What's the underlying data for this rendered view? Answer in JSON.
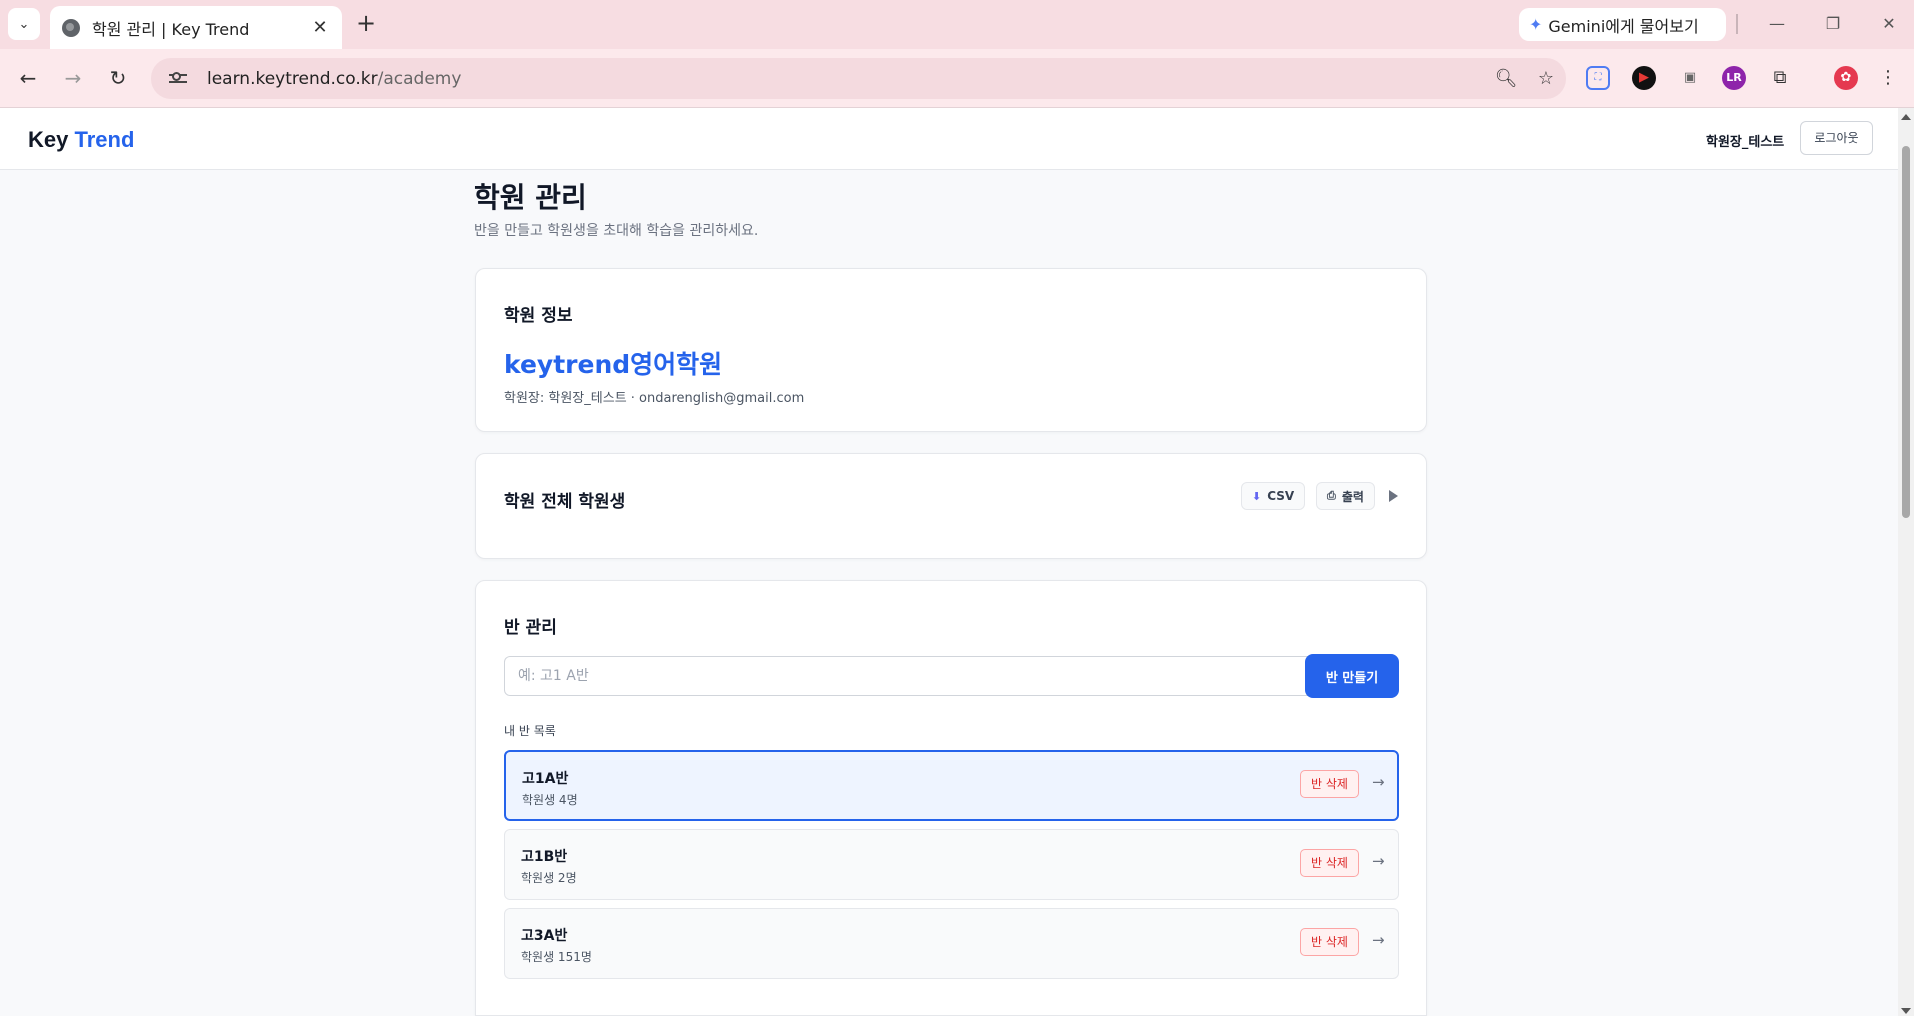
{
  "browser": {
    "tab_title": "학원 관리 | Key Trend",
    "gemini_label": "Gemini에게 물어보기",
    "url_host": "learn.keytrend.co.kr",
    "url_path": "/academy"
  },
  "header": {
    "logo_part1": "Key",
    "logo_part2": "Trend",
    "user_name": "학원장_테스트",
    "logout_label": "로그아웃"
  },
  "page": {
    "title": "학원 관리",
    "subtitle": "반을 만들고 학원생을 초대해 학습을 관리하세요."
  },
  "academy_info": {
    "section_title": "학원 정보",
    "name": "keytrend영어학원",
    "meta": "학원장: 학원장_테스트 · ondarenglish@gmail.com"
  },
  "all_students": {
    "section_title": "학원 전체 학원생",
    "csv_label": "CSV",
    "print_label": "출력"
  },
  "class_management": {
    "section_title": "반 관리",
    "input_placeholder": "예: 고1 A반",
    "input_value": "",
    "create_label": "반 만들기",
    "list_label": "내 반 목록",
    "classes": [
      {
        "name": "고1A반",
        "count": "학원생 4명",
        "delete_label": "반 삭제",
        "selected": true
      },
      {
        "name": "고1B반",
        "count": "학원생 2명",
        "delete_label": "반 삭제",
        "selected": false
      },
      {
        "name": "고3A반",
        "count": "학원생 151명",
        "delete_label": "반 삭제",
        "selected": false
      }
    ]
  },
  "colors": {
    "brand": "#2563eb",
    "danger": "#dc2626",
    "chrome_bg": "#f7dde2"
  }
}
